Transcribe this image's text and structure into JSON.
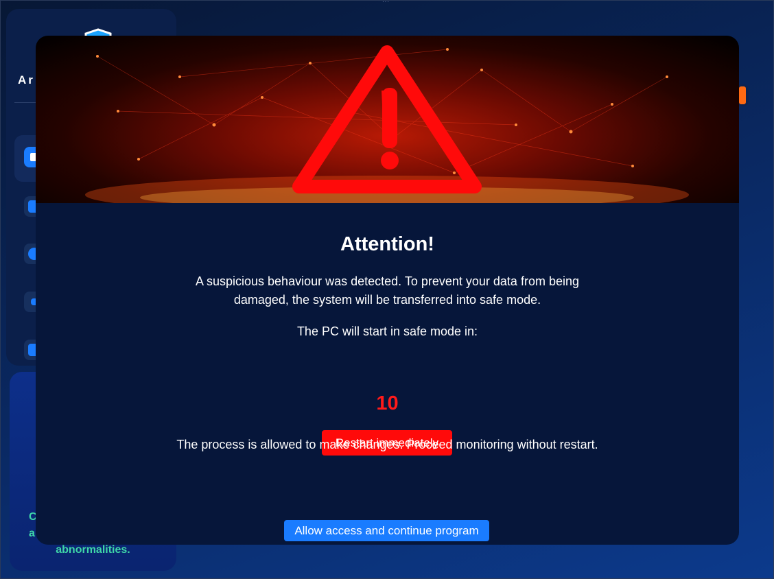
{
  "window": {
    "app_name": "Ar",
    "promo_text": "C a abnormalities.",
    "promo_lines": [
      "C",
      "a",
      "abnormalities."
    ]
  },
  "dialog": {
    "title": "Attention!",
    "message": "A suspicious behaviour was detected. To prevent your data from being damaged, the system will be transferred into safe mode.",
    "countdown_label": "The PC will start in safe mode in:",
    "countdown_value": "10",
    "restart_button": "Restart immediately",
    "allow_message": "The process  is allowed to make changes. Proceed monitoring without restart.",
    "allow_button": "Allow access and continue program",
    "banner_icon": "warning-triangle-icon"
  },
  "colors": {
    "accent_blue": "#1a7cff",
    "danger_red": "#ff0a0a",
    "countdown_red": "#ff1a1a",
    "promo_green": "#3fd6a8",
    "badge_orange": "#ff6a13"
  }
}
